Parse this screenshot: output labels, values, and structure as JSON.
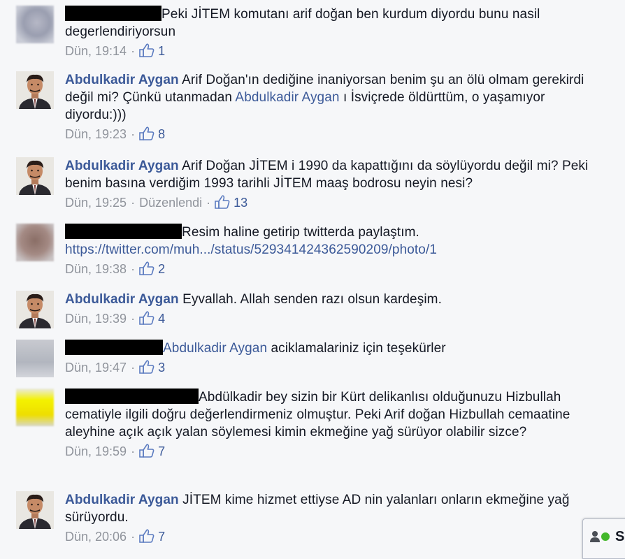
{
  "comments": [
    {
      "author": "",
      "redacted": true,
      "segments": [
        {
          "type": "text",
          "value": "Peki JİTEM komutanı arif doğan ben kurdum diyordu bunu nasil degerlendiriyorsun"
        }
      ],
      "time": "Dün, 19:14",
      "edited": "",
      "likes": "1"
    },
    {
      "author": "Abdulkadir Aygan",
      "redacted": false,
      "segments": [
        {
          "type": "text",
          "value": "Arif Doğan'ın dediğine inaniyorsan benim şu an ölü olmam gerekirdi değil mi? Çünkü utanmadan "
        },
        {
          "type": "mention",
          "value": "Abdulkadir Aygan"
        },
        {
          "type": "text",
          "value": " ı İsviçrede öldürttüm, o yaşamıyor diyordu:)))"
        }
      ],
      "time": "Dün, 19:23",
      "edited": "",
      "likes": "8"
    },
    {
      "author": "Abdulkadir Aygan",
      "redacted": false,
      "segments": [
        {
          "type": "text",
          "value": "Arif Doğan JİTEM i 1990 da kapattığını da söylüyordu değil mi? Peki benim basına verdiğim 1993 tarihli JİTEM maaş bodrosu neyin nesi?"
        }
      ],
      "time": "Dün, 19:25",
      "edited": "Düzenlendi",
      "likes": "13"
    },
    {
      "author": "",
      "redacted": true,
      "segments": [
        {
          "type": "text",
          "value": "Resim haline getirip twitterda paylaştım. "
        },
        {
          "type": "link",
          "value": "https://twitter.com/muh.../status/529341424362590209/photo/1"
        }
      ],
      "time": "Dün, 19:38",
      "edited": "",
      "likes": "2"
    },
    {
      "author": "Abdulkadir Aygan",
      "redacted": false,
      "segments": [
        {
          "type": "text",
          "value": "Eyvallah. Allah senden razı olsun kardeşim."
        }
      ],
      "time": "Dün, 19:39",
      "edited": "",
      "likes": "4"
    },
    {
      "author": "",
      "redacted": true,
      "segments": [
        {
          "type": "mention",
          "value": "Abdulkadir Aygan"
        },
        {
          "type": "text",
          "value": " aciklamalariniz için teşekürler"
        }
      ],
      "time": "Dün, 19:47",
      "edited": "",
      "likes": "3"
    },
    {
      "author": "",
      "redacted": true,
      "segments": [
        {
          "type": "text",
          "value": "Abdülkadir bey sizin bir Kürt delikanlısı olduğunuzu Hizbullah cematiyle ilgili doğru değerlendirmeniz olmuştur. Peki Arif doğan Hizbullah cemaatine aleyhine açık açık yalan söylemesi kimin ekmeğine yağ sürüyor olabilir sizce?"
        }
      ],
      "time": "Dün, 19:59",
      "edited": "",
      "likes": "7"
    },
    {
      "author": "Abdulkadir Aygan",
      "redacted": false,
      "segments": [
        {
          "type": "text",
          "value": "JİTEM kime hizmet ettiyse AD nin yalanları onların ekmeğine yağ sürüyordu."
        }
      ],
      "time": "Dün, 20:06",
      "edited": "",
      "likes": "7"
    }
  ],
  "chat": {
    "label": "S"
  },
  "colors": {
    "link": "#3b5998",
    "meta": "#90949c",
    "text": "#141823",
    "background": "#f6f7f9"
  },
  "icons": {
    "like": "thumbs-up-icon",
    "chat": "online-friends-icon"
  }
}
